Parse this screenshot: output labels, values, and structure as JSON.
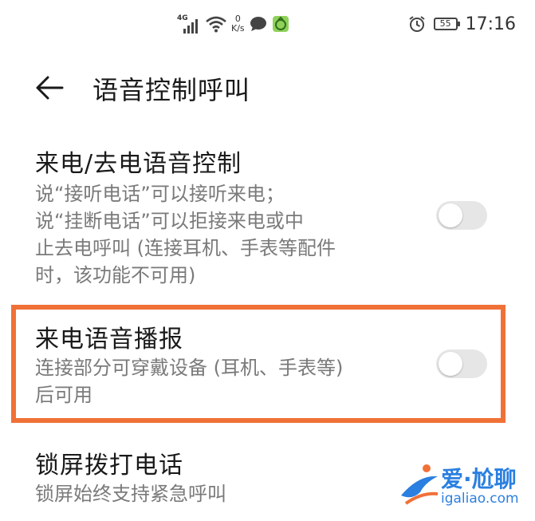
{
  "status_bar": {
    "network_type": "4G",
    "net_speed_value": "0",
    "net_speed_unit": "K/s",
    "battery_level": "55",
    "time": "17:16"
  },
  "header": {
    "title": "语音控制呼叫"
  },
  "settings": [
    {
      "title": "来电/去电语音控制",
      "description": [
        "说“接听电话”可以接听来电；",
        "说“挂断电话”可以拒接来电或中",
        "止去电呼叫 (连接耳机、手表等配件",
        "时，该功能不可用)"
      ],
      "enabled": false
    },
    {
      "title": "来电语音播报",
      "description": [
        "连接部分可穿戴设备 (耳机、手表等)",
        "后可用"
      ],
      "enabled": false,
      "highlighted": true
    },
    {
      "title": "锁屏拨打电话",
      "description": [
        "锁屏始终支持紧急呼叫"
      ]
    }
  ],
  "colors": {
    "highlight": "#f07138",
    "toggle_off": "#e6e6e6",
    "watermark": "#2a7fe0"
  },
  "watermark": {
    "brand": "爱·尬聊",
    "url": "igaliao.com"
  }
}
